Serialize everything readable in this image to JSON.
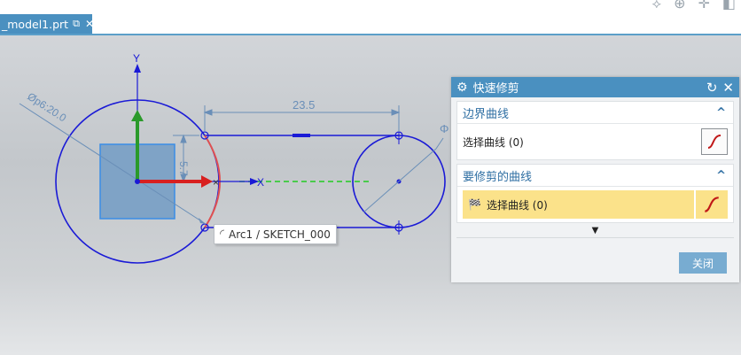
{
  "tab": {
    "title": "_model1.prt"
  },
  "tooltip": {
    "text": "Arc1 / SKETCH_000"
  },
  "sketch": {
    "dim_horizontal": "23.5",
    "dim_diameter": "Øp6:20.0",
    "dim_vertical": "5.7",
    "dim_right_partial": "Φ",
    "axis_y": "Y",
    "axis_x": "X"
  },
  "panel": {
    "title": "快速修剪",
    "group1": {
      "title": "边界曲线",
      "select_label": "选择曲线 (0)"
    },
    "group2": {
      "title": "要修剪的曲线",
      "select_label": "选择曲线 (0)"
    },
    "close_label": "关闭"
  },
  "colors": {
    "accent": "#4a90c0",
    "sketch_blue": "#1a1ad6",
    "highlight": "#fbe28a",
    "trim_red": "#e05050"
  }
}
